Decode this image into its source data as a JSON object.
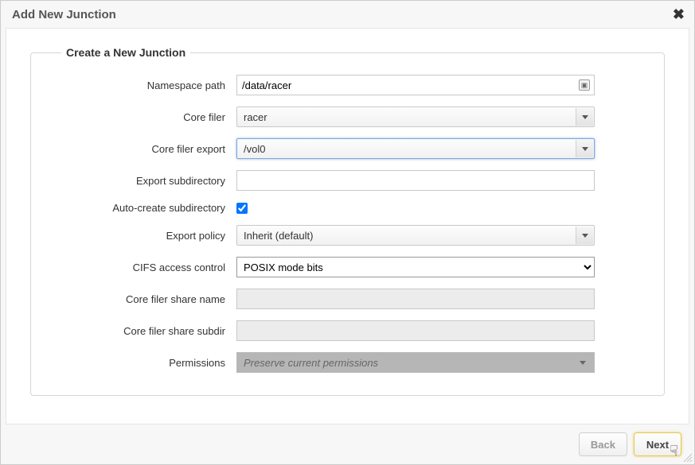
{
  "dialog_title": "Add New Junction",
  "fieldset_legend": "Create a New Junction",
  "labels": {
    "namespace_path": "Namespace path",
    "core_filer": "Core filer",
    "core_filer_export": "Core filer export",
    "export_subdirectory": "Export subdirectory",
    "auto_create": "Auto-create subdirectory",
    "export_policy": "Export policy",
    "cifs_access": "CIFS access control",
    "share_name": "Core filer share name",
    "share_subdir": "Core filer share subdir",
    "permissions": "Permissions"
  },
  "values": {
    "namespace_path": "/data/racer",
    "core_filer": "racer",
    "core_filer_export": "/vol0",
    "export_subdirectory": "",
    "auto_create_checked": true,
    "export_policy": "Inherit (default)",
    "cifs_access": "POSIX mode bits",
    "share_name": "",
    "share_subdir": "",
    "permissions": "Preserve current permissions"
  },
  "buttons": {
    "back": "Back",
    "next": "Next"
  }
}
